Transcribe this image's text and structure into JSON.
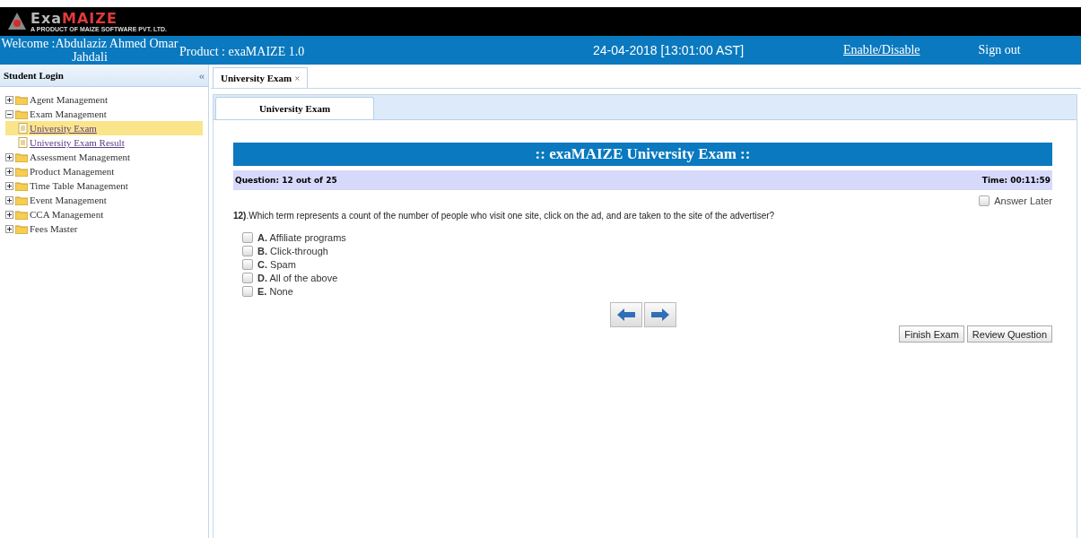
{
  "logo": {
    "word_left": "Exa",
    "word_right": "MAIZE",
    "tagline": "A PRODUCT OF MAIZE SOFTWARE PVT. LTD."
  },
  "header": {
    "welcome": "Welcome :Abdulaziz Ahmed Omar Jahdali",
    "product": "Product : exaMAIZE 1.0",
    "datetime": "24-04-2018 [13:01:00 AST]",
    "links": [
      "Enable/Disable",
      "Sign out"
    ]
  },
  "sidebar": {
    "title": "Student Login",
    "collapse": "«",
    "tree": [
      {
        "label": "Agent Management",
        "expanded": false
      },
      {
        "label": "Exam Management",
        "expanded": true,
        "children": [
          {
            "label": "University Exam",
            "selected": true
          },
          {
            "label": "University Exam Result",
            "selected": false
          }
        ]
      },
      {
        "label": "Assessment Management",
        "expanded": false
      },
      {
        "label": "Product Management",
        "expanded": false
      },
      {
        "label": "Time Table Management",
        "expanded": false
      },
      {
        "label": "Event Management",
        "expanded": false
      },
      {
        "label": "CCA Management",
        "expanded": false
      },
      {
        "label": "Fees Master",
        "expanded": false
      }
    ]
  },
  "tabs": [
    {
      "label": "University Exam",
      "close": "×",
      "selected": true
    }
  ],
  "panel_tabs": [
    {
      "label": "University Exam",
      "selected": true
    }
  ],
  "exam": {
    "title": ":: exaMAIZE University Exam ::",
    "progress": "Question: 12 out of 25",
    "timer": "Time: 00:11:59",
    "answer_later": {
      "label": "Answer Later",
      "checked": false
    },
    "question_number": "12)",
    "question": ".Which term represents a count of the number of people who visit one site, click on the ad, and are taken to the site of the advertiser?",
    "options": [
      {
        "letter": "A.",
        "text": "Affiliate programs",
        "checked": false
      },
      {
        "letter": "B.",
        "text": "Click-through",
        "checked": false
      },
      {
        "letter": "C.",
        "text": "Spam",
        "checked": false
      },
      {
        "letter": "D.",
        "text": "All of the above",
        "checked": false
      },
      {
        "letter": "E.",
        "text": "None",
        "checked": false
      }
    ],
    "buttons": [
      "Finish Exam",
      "Review Question"
    ]
  }
}
